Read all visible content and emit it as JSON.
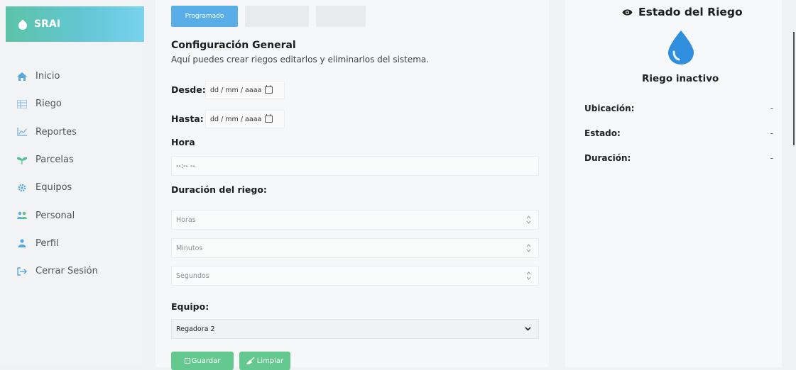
{
  "brand": {
    "name": "SRAI"
  },
  "sidebar": {
    "items": [
      {
        "label": "Inicio",
        "icon": "home-icon"
      },
      {
        "label": "Riego",
        "icon": "table-icon"
      },
      {
        "label": "Reportes",
        "icon": "line-chart-icon"
      },
      {
        "label": "Parcelas",
        "icon": "plant-icon"
      },
      {
        "label": "Equipos",
        "icon": "gear-icon"
      },
      {
        "label": "Personal",
        "icon": "users-icon"
      },
      {
        "label": "Perfil",
        "icon": "user-icon"
      },
      {
        "label": "Cerrar Sesión",
        "icon": "logout-icon"
      }
    ]
  },
  "tabs": [
    {
      "label": "Programado",
      "active": true
    },
    {
      "label": ""
    },
    {
      "label": ""
    }
  ],
  "form": {
    "title": "Configuración General",
    "subtitle": "Aquí puedes crear riegos editarlos y eliminarlos del sistema.",
    "desde_label": "Desde:",
    "hasta_label": "Hasta:",
    "date_placeholder": "dd / mm / aaaa",
    "hora_label": "Hora",
    "hora_placeholder": "--:-- --",
    "duracion_label": "Duración del riego:",
    "horas_placeholder": "Horas",
    "minutos_placeholder": "Minutos",
    "segundos_placeholder": "Segundos",
    "equipo_label": "Equipo:",
    "equipo_selected": "Regadora 2",
    "save_label": "Guardar",
    "clear_label": "Limpiar"
  },
  "status_panel": {
    "title": "Estado del Riego",
    "status": "Riego inactivo",
    "fields": [
      {
        "label": "Ubicación:",
        "value": "-"
      },
      {
        "label": "Estado:",
        "value": "-"
      },
      {
        "label": "Duración:",
        "value": "-"
      }
    ]
  },
  "colors": {
    "brand_gradient_start": "#5cc3a8",
    "brand_gradient_end": "#79d3ee",
    "tab_active": "#5aaee8",
    "button_green": "#63c98f",
    "drop_blue": "#2f8fde",
    "icon_blue": "#58a9e0"
  }
}
